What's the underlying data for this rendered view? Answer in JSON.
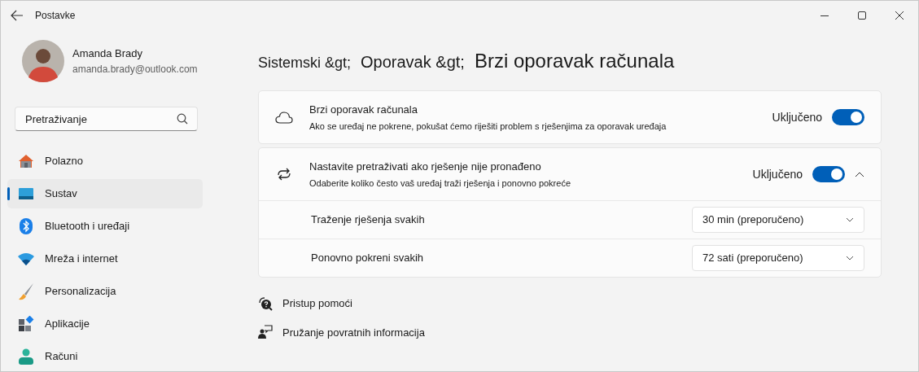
{
  "window": {
    "title": "Postavke"
  },
  "account": {
    "name": "Amanda Brady",
    "email": "amanda.brady@outlook.com"
  },
  "search": {
    "placeholder": "Pretraživanje"
  },
  "sidebar": {
    "items": [
      {
        "label": "Polazno",
        "kind": "home",
        "selected": false
      },
      {
        "label": "Sustav",
        "kind": "system",
        "selected": true
      },
      {
        "label": "Bluetooth i uređaji",
        "kind": "bluetooth",
        "selected": false
      },
      {
        "label": "Mreža i internet",
        "kind": "wifi",
        "selected": false
      },
      {
        "label": "Personalizacija",
        "kind": "brush",
        "selected": false
      },
      {
        "label": "Aplikacije",
        "kind": "apps",
        "selected": false
      },
      {
        "label": "Računi",
        "kind": "person",
        "selected": false
      }
    ]
  },
  "breadcrumb": [
    "Sistemski &gt;",
    "Oporavak &gt;",
    "Brzi oporavak računala"
  ],
  "cards": [
    {
      "kind": "cloud",
      "title": "Brzi oporavak računala",
      "description": "Ako se uređaj ne pokrene, pokušat ćemo riješiti problem s rješenjima za oporavak uređaja",
      "toggle_label": "Uključeno",
      "on": true
    },
    {
      "kind": "refresh",
      "title": "Nastavite pretraživati ako rješenje nije pronađeno",
      "description": "Odaberite koliko često vaš uređaj traži rješenja i ponovno pokreće",
      "toggle_label": "Uključeno",
      "on": true,
      "expanded": true,
      "settings": [
        {
          "label": "Traženje rješenja svakih",
          "value": "30 min (preporučeno)"
        },
        {
          "label": "Ponovno pokreni svakih",
          "value": "72 sati (preporučeno)"
        }
      ]
    }
  ],
  "links": [
    {
      "kind": "help",
      "label": "Pristup pomoći"
    },
    {
      "kind": "feedback",
      "label": "Pružanje povratnih informacija"
    }
  ]
}
